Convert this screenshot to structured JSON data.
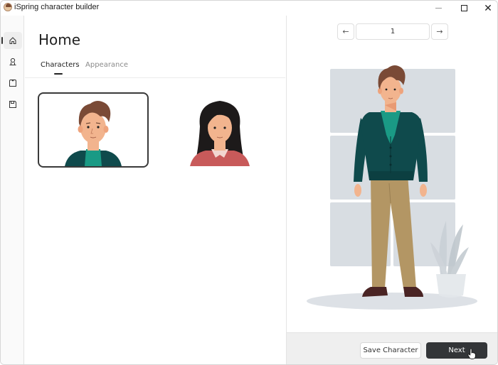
{
  "window": {
    "title": "iSpring character builder",
    "controls": {
      "minimize": "minimize",
      "maximize": "maximize",
      "close": "close"
    }
  },
  "sidebar": {
    "items": [
      {
        "name": "home",
        "icon": "home-icon",
        "active": true
      },
      {
        "name": "characters",
        "icon": "person-icon",
        "active": false
      },
      {
        "name": "clothes",
        "icon": "shirt-icon",
        "active": false
      },
      {
        "name": "save",
        "icon": "floppy-disk-icon",
        "active": false
      }
    ]
  },
  "main": {
    "title": "Home",
    "tabs": [
      {
        "label": "Characters",
        "active": true
      },
      {
        "label": "Appearance",
        "active": false
      }
    ],
    "characters": [
      {
        "label": "male character with brown hair and teal cardigan",
        "selected": true
      },
      {
        "label": "female character with black hair and red top",
        "selected": false
      }
    ]
  },
  "preview": {
    "pager": {
      "prev_icon": "←",
      "next_icon": "→",
      "value": "1"
    },
    "colors": {
      "cardigan": "#0f4a4c",
      "shirt": "#1a9a85",
      "pants": "#b39664",
      "hair": "#7a4a36",
      "skin": "#f2b48e",
      "shoes": "#4a2424",
      "backdrop": "#d8dde2"
    }
  },
  "footer": {
    "save_label": "Save Character",
    "next_label": "Next"
  }
}
